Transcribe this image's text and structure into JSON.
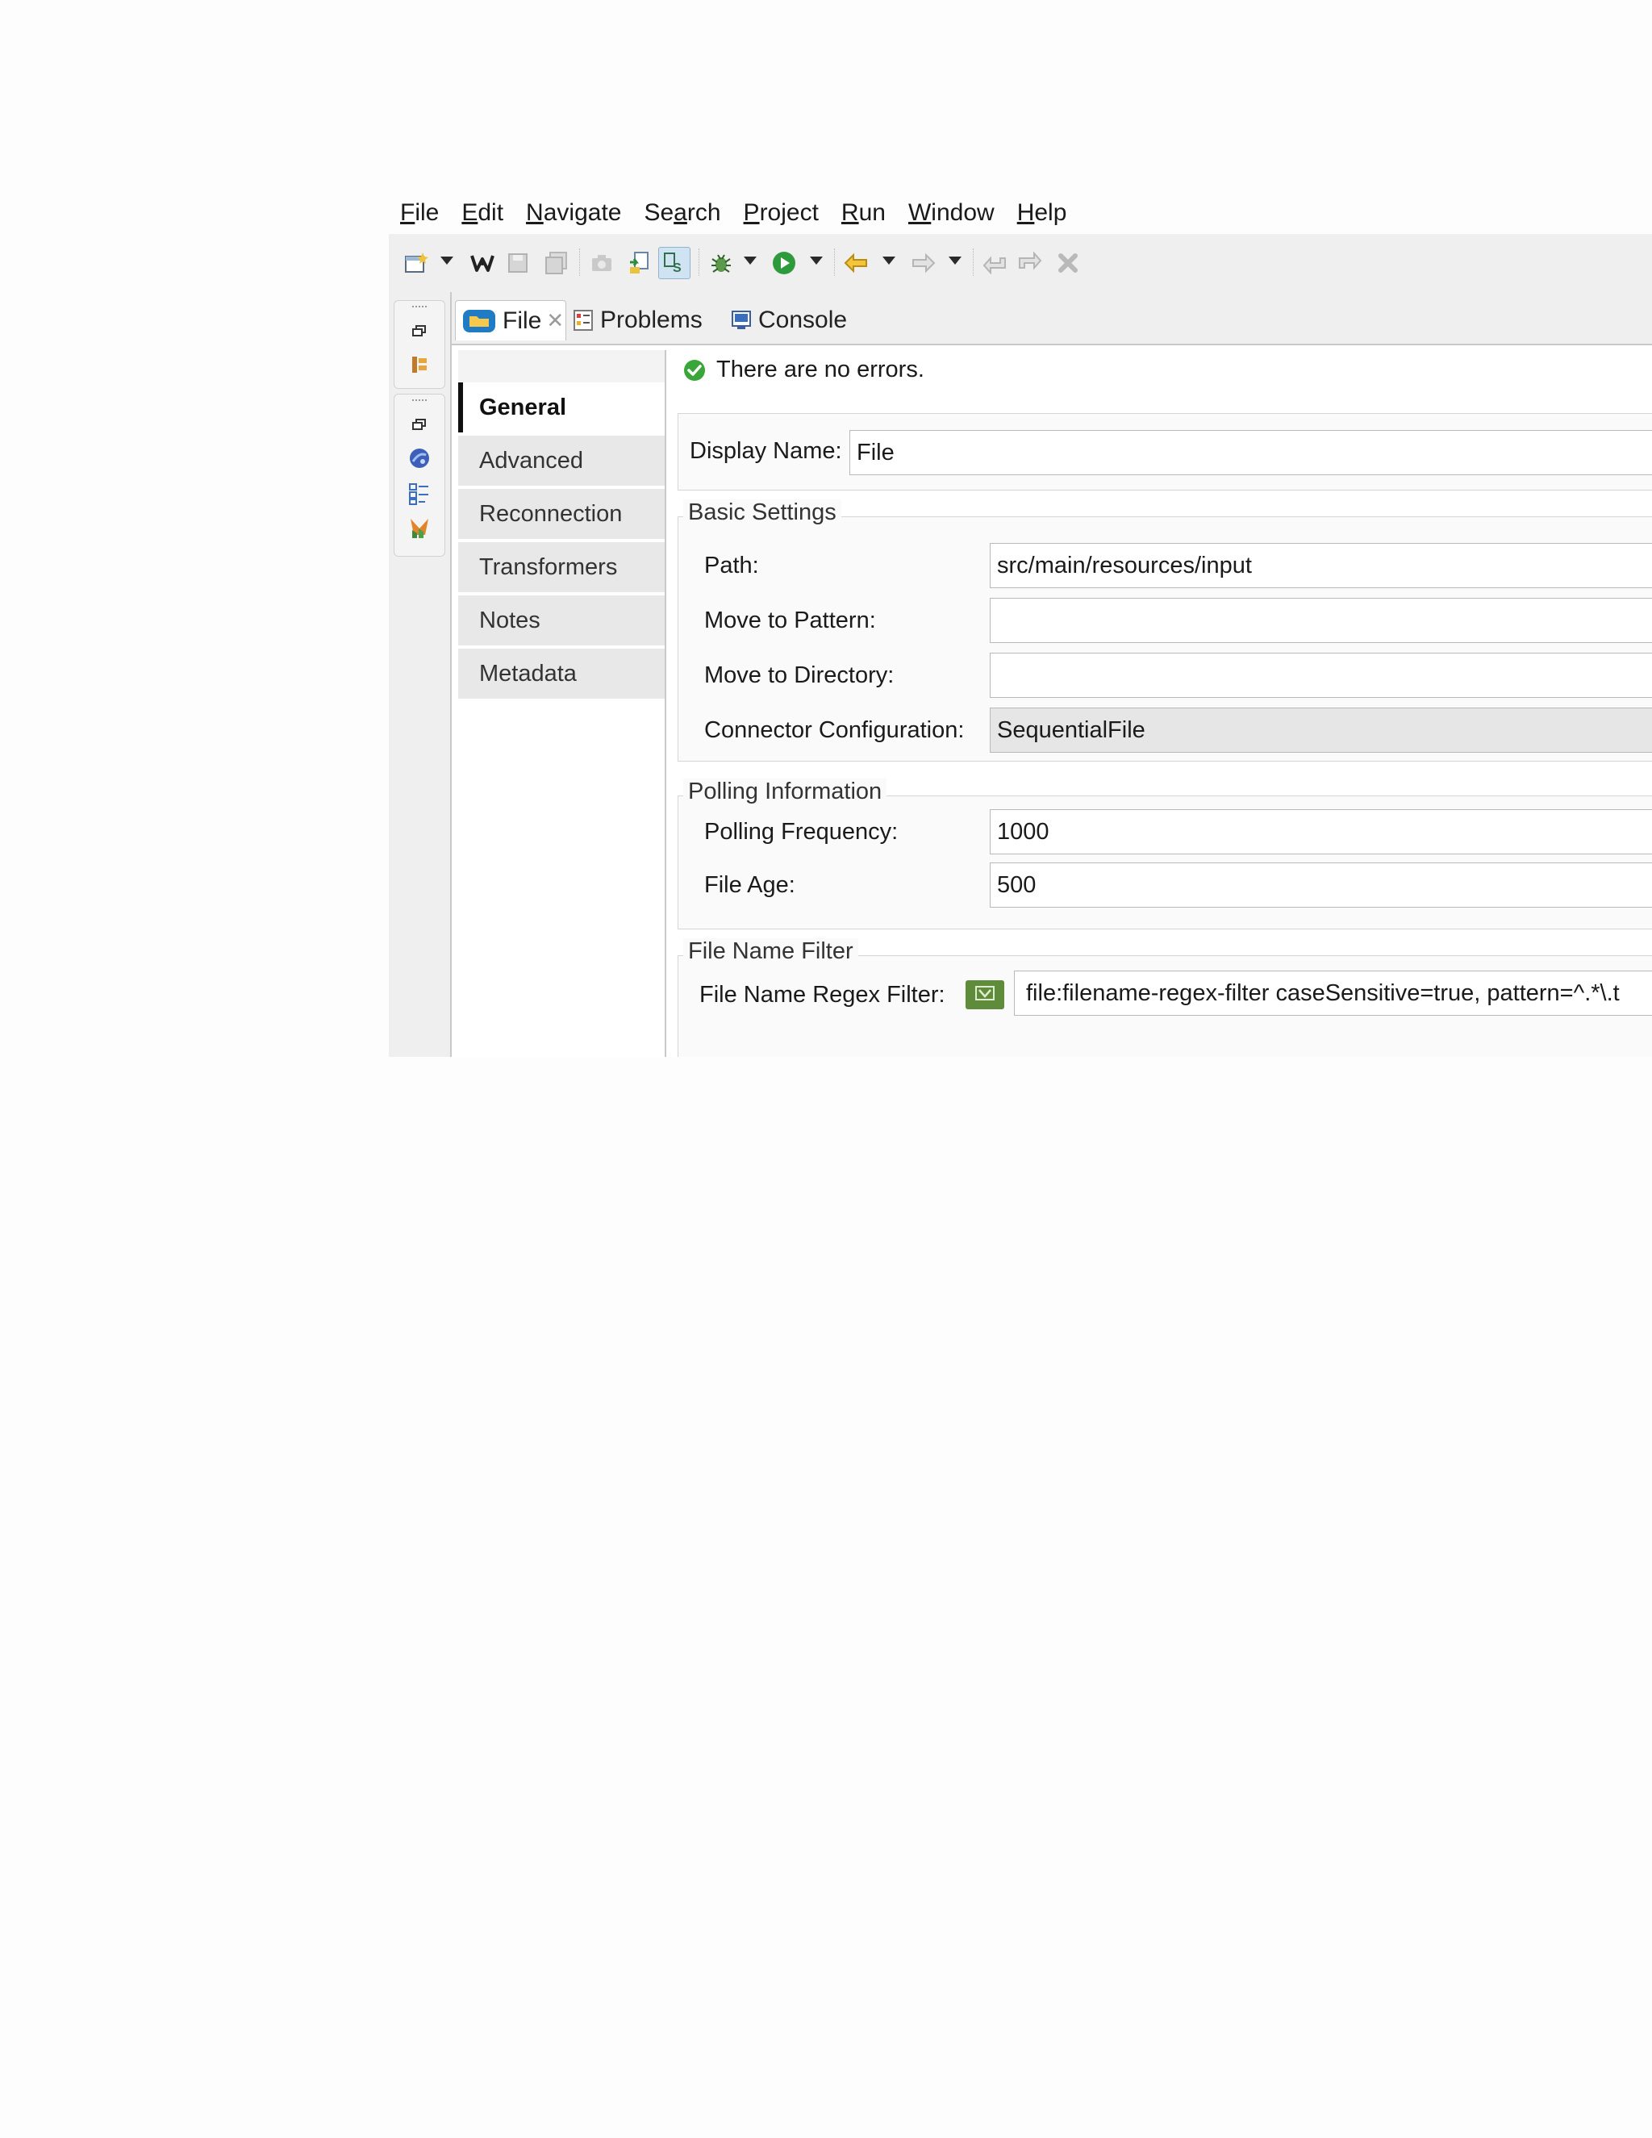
{
  "menubar": {
    "items": [
      {
        "mnemonic": "F",
        "rest": "ile"
      },
      {
        "mnemonic": "E",
        "rest": "dit"
      },
      {
        "mnemonic": "N",
        "rest": "avigate"
      },
      {
        "pre": "Se",
        "mnemonic": "a",
        "rest": "rch"
      },
      {
        "mnemonic": "P",
        "rest": "roject"
      },
      {
        "mnemonic": "R",
        "rest": "un"
      },
      {
        "mnemonic": "W",
        "rest": "indow"
      },
      {
        "mnemonic": "H",
        "rest": "elp"
      }
    ]
  },
  "toolbar": {
    "icons": [
      "new-wizard-icon",
      "dropdown-caret-icon",
      "mule-icon",
      "save-icon",
      "save-all-icon",
      "camera-icon",
      "open-type-icon",
      "xs-icon",
      "debug-icon",
      "dropdown-caret-icon",
      "run-icon",
      "dropdown-caret-icon",
      "back-icon",
      "dropdown-caret-icon",
      "forward-icon",
      "dropdown-caret-icon",
      "undo-icon",
      "redo-icon",
      "close-red-icon"
    ]
  },
  "tabs": [
    {
      "label": "File",
      "active": true,
      "icon": "folder-icon"
    },
    {
      "label": "Problems",
      "active": false,
      "icon": "problems-icon"
    },
    {
      "label": "Console",
      "active": false,
      "icon": "console-icon"
    }
  ],
  "side_nav": {
    "items": [
      "General",
      "Advanced",
      "Reconnection",
      "Transformers",
      "Notes",
      "Metadata"
    ],
    "selected": "General"
  },
  "status": {
    "text": "There are no errors.",
    "icon": "check-circle-icon",
    "color": "#3aa639"
  },
  "form": {
    "display_name_label": "Display Name:",
    "display_name_value": "File",
    "basic": {
      "legend": "Basic Settings",
      "path_label": "Path:",
      "path_value": "src/main/resources/input",
      "move_pattern_label": "Move to Pattern:",
      "move_pattern_value": "",
      "move_dir_label": "Move to Directory:",
      "move_dir_value": "",
      "connector_label": "Connector Configuration:",
      "connector_value": "SequentialFile"
    },
    "polling": {
      "legend": "Polling Information",
      "frequency_label": "Polling Frequency:",
      "frequency_value": "1000",
      "age_label": "File Age:",
      "age_value": "500"
    },
    "filter": {
      "legend": "File Name Filter",
      "regex_label": "File Name Regex Filter:",
      "regex_value": "file:filename-regex-filter caseSensitive=true, pattern=^.*\\.t"
    }
  }
}
